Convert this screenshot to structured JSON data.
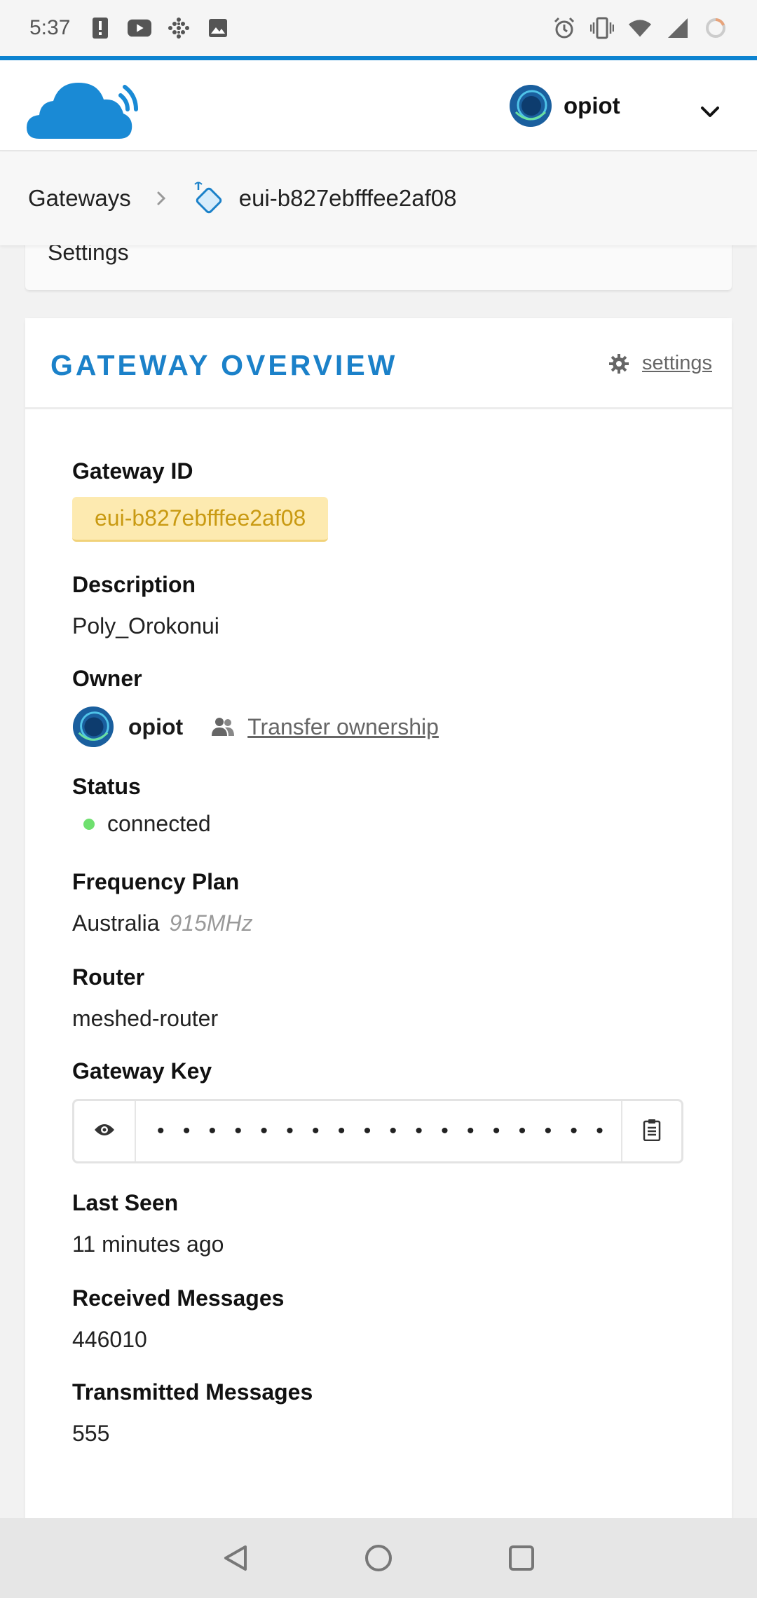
{
  "status_bar": {
    "time": "5:37",
    "left_icons": [
      "alert-icon",
      "youtube-icon",
      "dots-grid-icon",
      "image-icon"
    ],
    "right_icons": [
      "alarm-icon",
      "vibrate-icon",
      "wifi-icon",
      "cell-signal-icon",
      "battery-icon"
    ]
  },
  "header": {
    "logo": "cloud-logo",
    "user": {
      "name": "opiot"
    }
  },
  "breadcrumb": {
    "root": "Gateways",
    "current": "eui-b827ebfffee2af08"
  },
  "settings_card": {
    "label": "Settings"
  },
  "overview": {
    "title": "GATEWAY OVERVIEW",
    "settings_link": "settings",
    "fields": {
      "gateway_id": {
        "label": "Gateway ID",
        "value": "eui-b827ebfffee2af08"
      },
      "description": {
        "label": "Description",
        "value": "Poly_Orokonui"
      },
      "owner": {
        "label": "Owner",
        "name": "opiot",
        "transfer": "Transfer ownership"
      },
      "status": {
        "label": "Status",
        "value": "connected"
      },
      "frequency_plan": {
        "label": "Frequency Plan",
        "value": "Australia",
        "detail": "915MHz"
      },
      "router": {
        "label": "Router",
        "value": "meshed-router"
      },
      "gateway_key": {
        "label": "Gateway Key",
        "masked": "• • • • • • • • • • • • • • • • • • • • • • • • • • • •",
        "encoding": "base64"
      },
      "last_seen": {
        "label": "Last Seen",
        "value": "11 minutes ago"
      },
      "received": {
        "label": "Received Messages",
        "value": "446010"
      },
      "transmitted": {
        "label": "Transmitted Messages",
        "value": "555"
      }
    }
  },
  "colors": {
    "accent": "#1b81c9",
    "id_badge_bg": "#fdeab0",
    "id_badge_text": "#c99a12",
    "status_connected": "#6fe06f"
  },
  "nav_bar": [
    "back-icon",
    "home-icon",
    "recents-icon"
  ]
}
